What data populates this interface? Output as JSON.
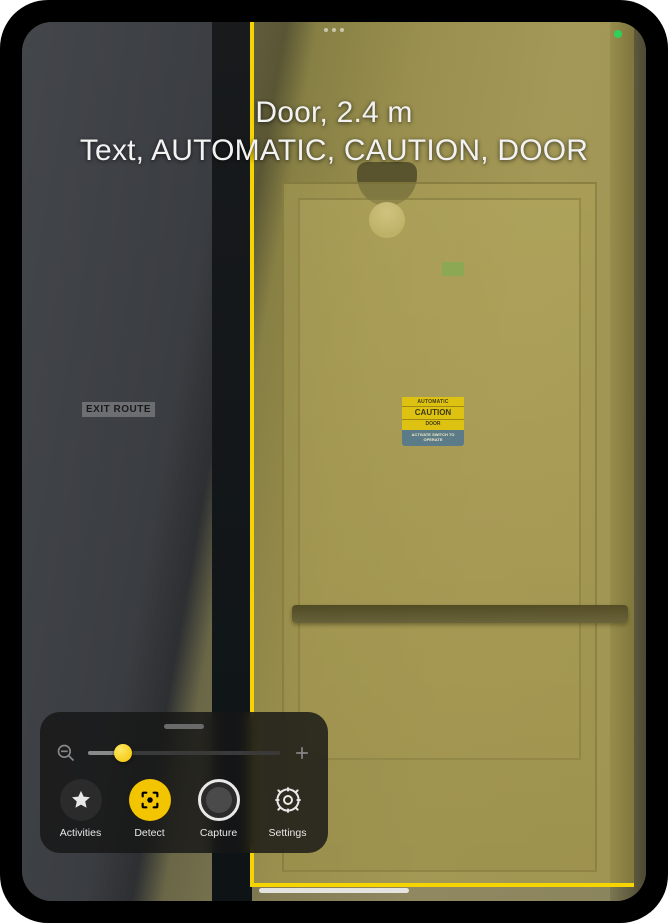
{
  "status": {
    "camera_active": true
  },
  "detection": {
    "line1": "Door, 2.4 m",
    "line2": "Text, AUTOMATIC, CAUTION, DOOR",
    "highlight_color": "#f5d400"
  },
  "scene_text": {
    "exit_route": "EXIT ROUTE",
    "sign": {
      "top": "AUTOMATIC",
      "mid": "CAUTION",
      "door": "DOOR",
      "note": "ACTIVATE SWITCH TO OPERATE"
    }
  },
  "panel": {
    "zoom": {
      "min_icon": "zoom-out",
      "max_icon": "zoom-in",
      "value_percent": 18
    },
    "modes": {
      "activities": {
        "label": "Activities",
        "icon": "star-icon",
        "active": false
      },
      "detect": {
        "label": "Detect",
        "icon": "detect-icon",
        "active": true
      },
      "capture": {
        "label": "Capture",
        "icon": "capture-icon",
        "active": false
      },
      "settings": {
        "label": "Settings",
        "icon": "gear-icon",
        "active": false
      }
    }
  }
}
